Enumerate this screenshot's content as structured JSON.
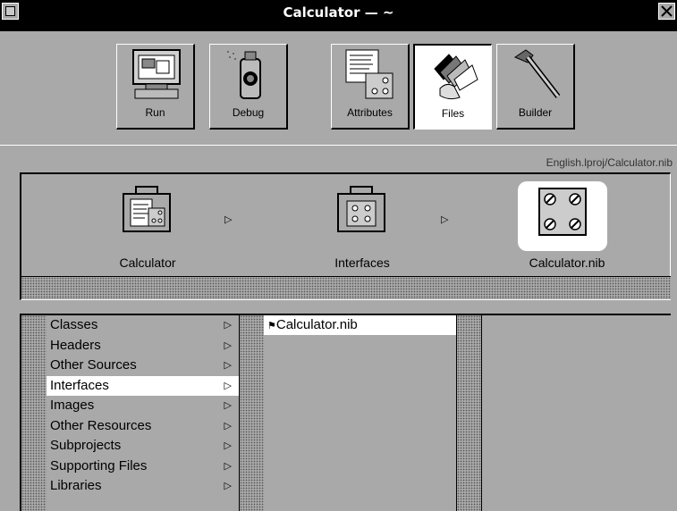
{
  "window": {
    "title": "Calculator — ~"
  },
  "toolbar": {
    "buttons": [
      {
        "label": "Run"
      },
      {
        "label": "Debug"
      },
      {
        "label": "Attributes"
      },
      {
        "label": "Files"
      },
      {
        "label": "Builder"
      }
    ],
    "selected": "Files"
  },
  "path_label": "English.lproj/Calculator.nib",
  "browser_path": [
    {
      "label": "Calculator",
      "icon": "project-suitcase-icon"
    },
    {
      "label": "Interfaces",
      "icon": "interfaces-suitcase-icon"
    },
    {
      "label": "Calculator.nib",
      "icon": "nib-file-icon",
      "selected": true
    }
  ],
  "column1": {
    "items": [
      {
        "label": "Classes"
      },
      {
        "label": "Headers"
      },
      {
        "label": "Other Sources"
      },
      {
        "label": "Interfaces",
        "selected": true
      },
      {
        "label": "Images"
      },
      {
        "label": "Other Resources"
      },
      {
        "label": "Subprojects"
      },
      {
        "label": "Supporting Files"
      },
      {
        "label": "Libraries"
      }
    ]
  },
  "column2": {
    "items": [
      {
        "label": "Calculator.nib",
        "selected": true,
        "icon": "flag-icon"
      }
    ]
  }
}
